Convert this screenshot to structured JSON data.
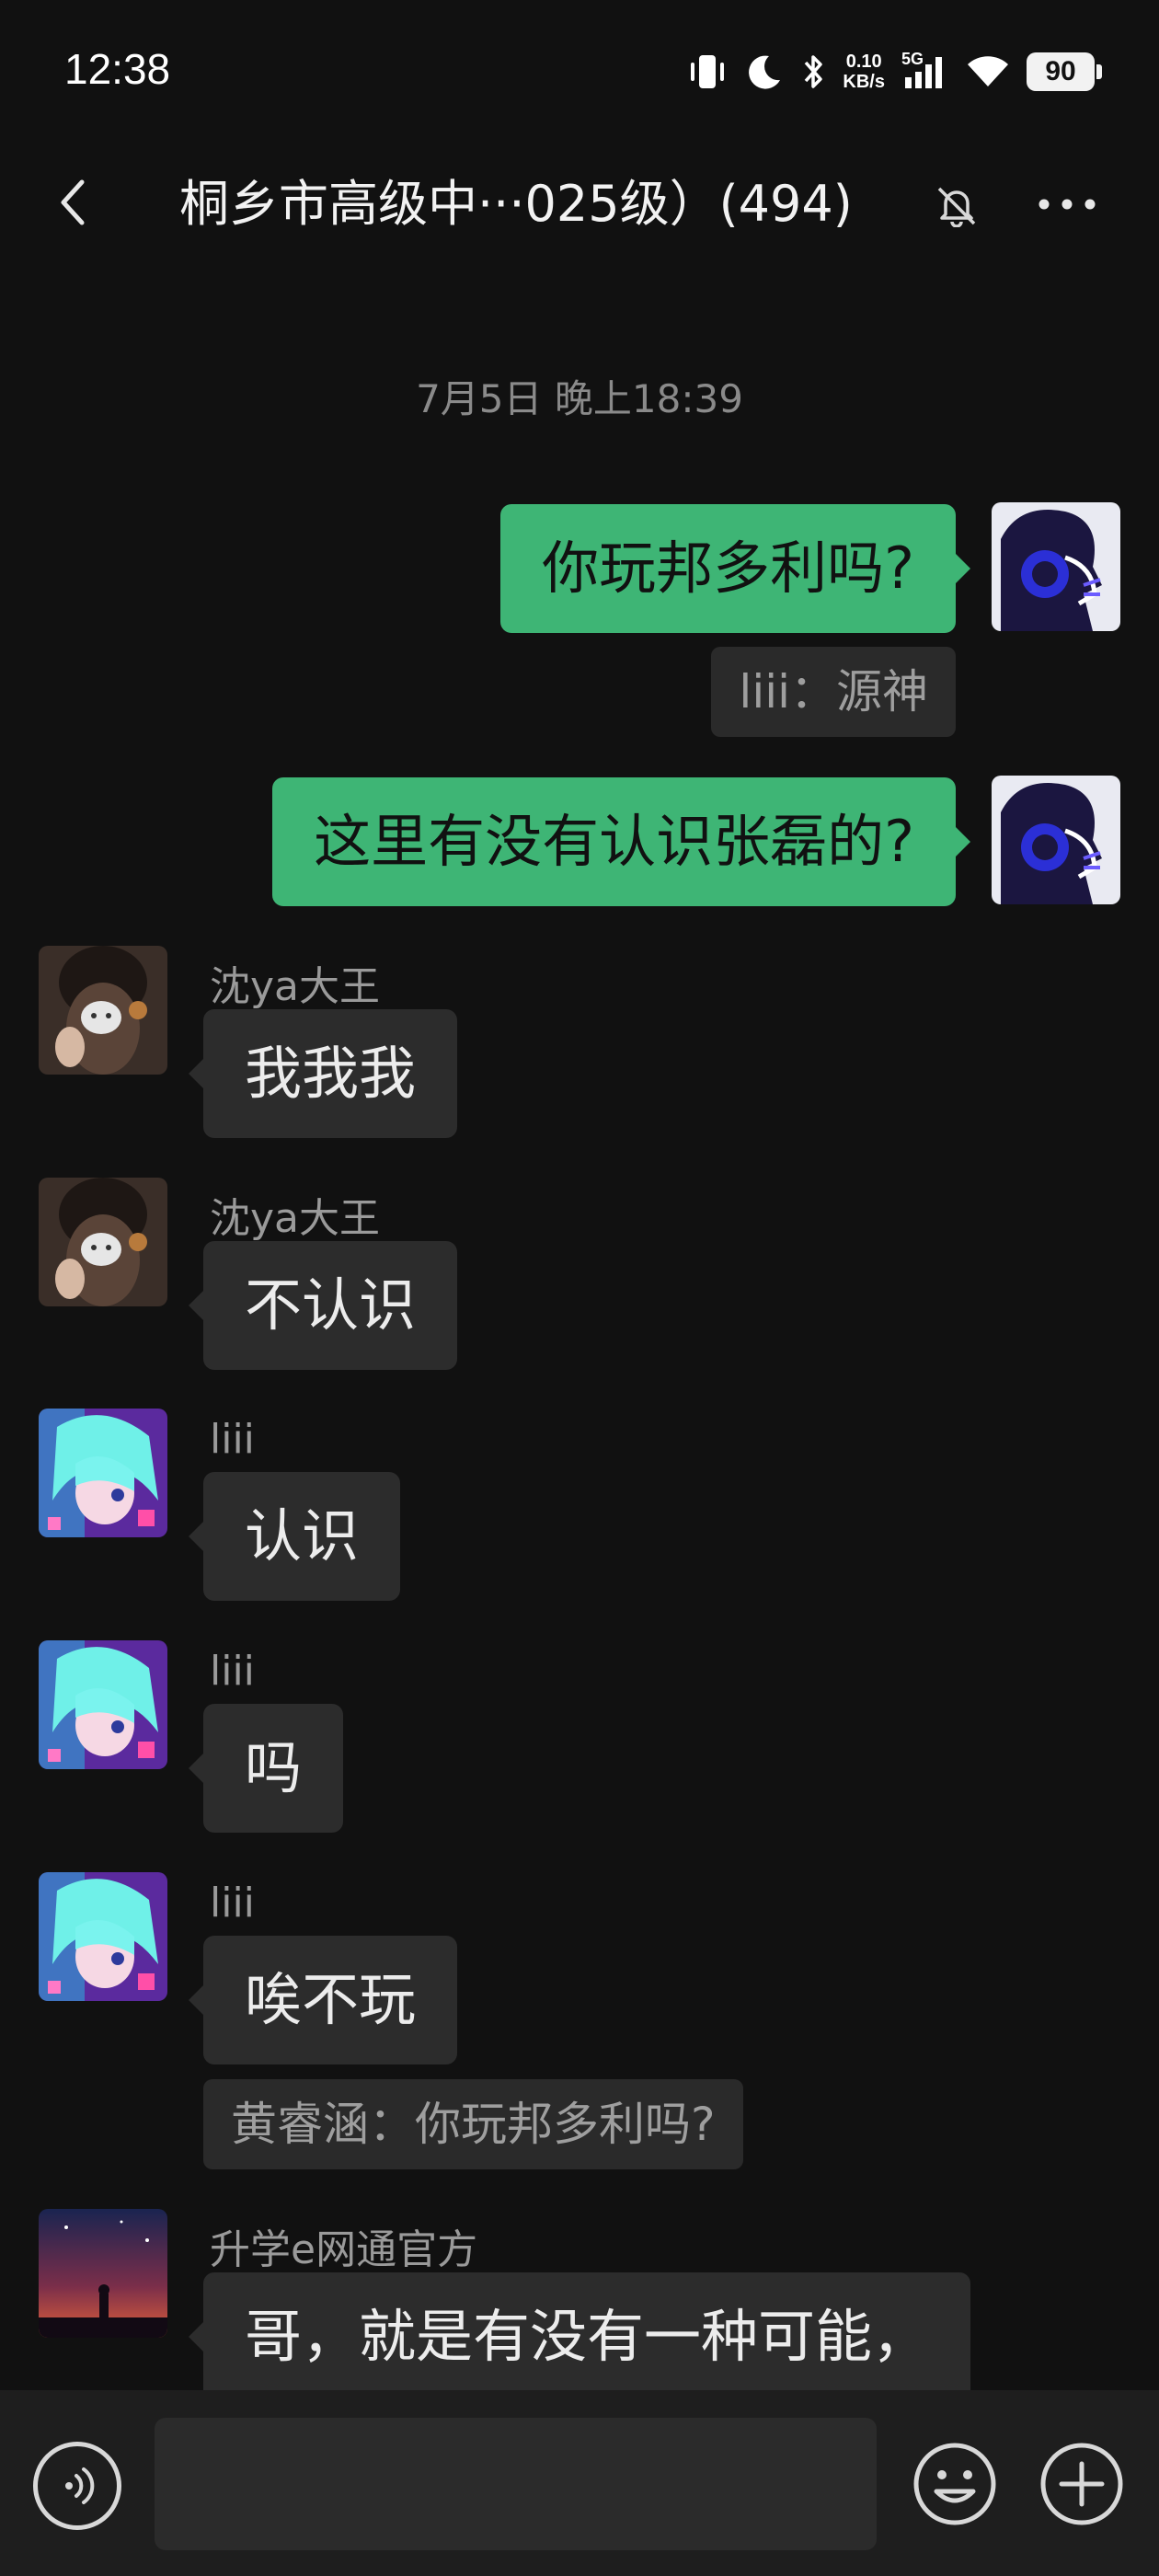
{
  "status_bar": {
    "time": "12:38",
    "net_speed_value": "0.10",
    "net_speed_unit": "KB/s",
    "network": "5G",
    "battery": "90"
  },
  "header": {
    "title": "桐乡市高级中···025级）(494)"
  },
  "chat": {
    "timestamp": "7月5日 晚上18:39",
    "messages": [
      {
        "direction": "out",
        "text": "你玩邦多利吗?"
      },
      {
        "direction": "out",
        "quote": "liii：源神"
      },
      {
        "direction": "out",
        "text": "这里有没有认识张磊的?"
      },
      {
        "direction": "in",
        "sender": "沈ya大王",
        "text": "我我我"
      },
      {
        "direction": "in",
        "sender": "沈ya大王",
        "text": "不认识"
      },
      {
        "direction": "in",
        "sender": "liii",
        "text": "认识"
      },
      {
        "direction": "in",
        "sender": "liii",
        "text": "吗"
      },
      {
        "direction": "in",
        "sender": "liii",
        "text": "唉不玩"
      },
      {
        "direction": "in",
        "quote": "黄睿涵：你玩邦多利吗?"
      },
      {
        "direction": "in",
        "sender": "升学e网通官方",
        "text": "哥，就是有没有一种可能，"
      }
    ]
  },
  "input_bar": {
    "placeholder": ""
  },
  "icons": {
    "back": "chevron-left-icon",
    "mute": "bell-off-icon",
    "more": "more-dots-icon",
    "voice": "voice-icon",
    "emoji": "emoji-icon",
    "plus": "plus-icon"
  },
  "colors": {
    "background": "#111111",
    "outgoing_bubble": "#3eb575",
    "incoming_bubble": "#2c2c2c",
    "input_bar": "#1e1e1e"
  }
}
